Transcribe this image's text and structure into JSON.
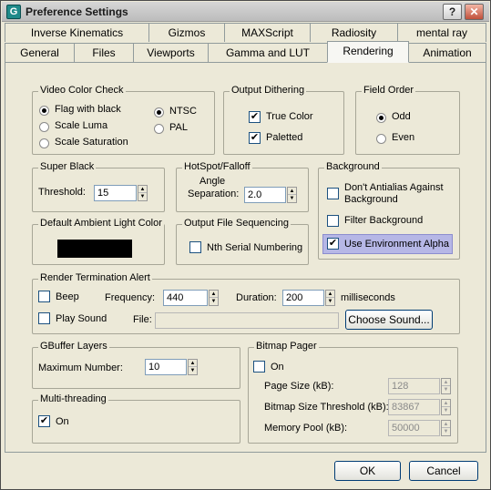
{
  "window": {
    "title": "Preference Settings",
    "icon_letter": "G",
    "help_label": "?",
    "close_label": "✕"
  },
  "tabs_row_back": [
    "Inverse Kinematics",
    "Gizmos",
    "MAXScript",
    "Radiosity",
    "mental ray"
  ],
  "tabs_row_front": [
    "General",
    "Files",
    "Viewports",
    "Gamma and LUT",
    "Rendering",
    "Animation"
  ],
  "active_tab": "Rendering",
  "video_color_check": {
    "title": "Video Color Check",
    "options": [
      "Flag with black",
      "Scale Luma",
      "Scale Saturation"
    ],
    "standards": [
      "NTSC",
      "PAL"
    ]
  },
  "output_dithering": {
    "title": "Output Dithering",
    "true_color": "True Color",
    "paletted": "Paletted"
  },
  "field_order": {
    "title": "Field Order",
    "odd": "Odd",
    "even": "Even"
  },
  "super_black": {
    "title": "Super Black",
    "threshold_label": "Threshold:",
    "threshold_value": "15"
  },
  "hotspot": {
    "title": "HotSpot/Falloff",
    "angle_label_1": "Angle",
    "angle_label_2": "Separation:",
    "angle_value": "2.0"
  },
  "background": {
    "title": "Background",
    "dont_antialias_1": "Don't Antialias Against",
    "dont_antialias_2": "Background",
    "filter": "Filter Background",
    "use_env_alpha": "Use Environment Alpha"
  },
  "ambient": {
    "title": "Default Ambient Light Color",
    "color": "#000000"
  },
  "sequencing": {
    "title": "Output File Sequencing",
    "nth": "Nth Serial Numbering"
  },
  "render_alert": {
    "title": "Render Termination Alert",
    "beep": "Beep",
    "frequency_label": "Frequency:",
    "frequency_value": "440",
    "duration_label": "Duration:",
    "duration_value": "200",
    "ms": "milliseconds",
    "play_sound": "Play Sound",
    "file_label": "File:",
    "file_value": "",
    "choose_sound": "Choose Sound..."
  },
  "gbuffer": {
    "title": "GBuffer Layers",
    "max_label": "Maximum Number:",
    "max_value": "10"
  },
  "multithreading": {
    "title": "Multi-threading",
    "on": "On"
  },
  "bitmap_pager": {
    "title": "Bitmap Pager",
    "on": "On",
    "page_size_label": "Page Size (kB):",
    "page_size_value": "128",
    "threshold_label": "Bitmap Size Threshold (kB):",
    "threshold_value": "83867",
    "memory_label": "Memory Pool (kB):",
    "memory_value": "50000"
  },
  "footer": {
    "ok": "OK",
    "cancel": "Cancel"
  }
}
